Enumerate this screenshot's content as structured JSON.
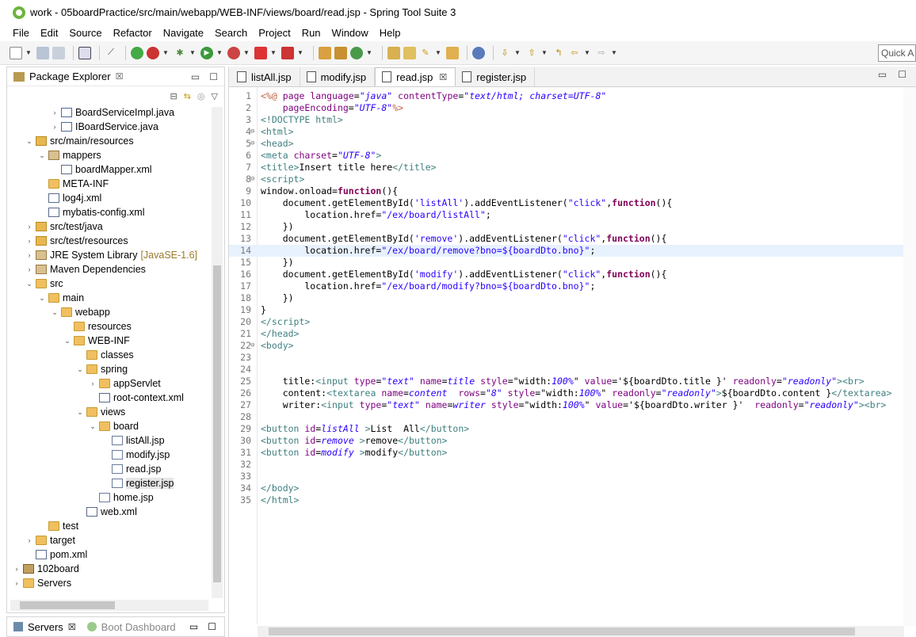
{
  "window": {
    "title": "work - 05boardPractice/src/main/webapp/WEB-INF/views/board/read.jsp - Spring Tool Suite 3"
  },
  "menu": [
    "File",
    "Edit",
    "Source",
    "Refactor",
    "Navigate",
    "Search",
    "Project",
    "Run",
    "Window",
    "Help"
  ],
  "toolbar": {
    "quick_access_placeholder": "Quick A"
  },
  "package_explorer": {
    "tab_label": "Package Explorer",
    "tree": [
      {
        "depth": 3,
        "arrow": ">",
        "icon": "java",
        "label": "BoardServiceImpl.java"
      },
      {
        "depth": 3,
        "arrow": ">",
        "icon": "java",
        "label": "IBoardService.java"
      },
      {
        "depth": 1,
        "arrow": "v",
        "icon": "pkgfolder",
        "label": "src/main/resources"
      },
      {
        "depth": 2,
        "arrow": "v",
        "icon": "pkg",
        "label": "mappers"
      },
      {
        "depth": 3,
        "arrow": "",
        "icon": "xml",
        "label": "boardMapper.xml"
      },
      {
        "depth": 2,
        "arrow": "",
        "icon": "folder",
        "label": "META-INF"
      },
      {
        "depth": 2,
        "arrow": "",
        "icon": "xml",
        "label": "log4j.xml"
      },
      {
        "depth": 2,
        "arrow": "",
        "icon": "xml",
        "label": "mybatis-config.xml"
      },
      {
        "depth": 1,
        "arrow": ">",
        "icon": "pkgfolder",
        "label": "src/test/java"
      },
      {
        "depth": 1,
        "arrow": ">",
        "icon": "pkgfolder",
        "label": "src/test/resources"
      },
      {
        "depth": 1,
        "arrow": ">",
        "icon": "lib",
        "label": "JRE System Library",
        "decor": "[JavaSE-1.6]"
      },
      {
        "depth": 1,
        "arrow": ">",
        "icon": "lib",
        "label": "Maven Dependencies"
      },
      {
        "depth": 1,
        "arrow": "v",
        "icon": "folder",
        "label": "src"
      },
      {
        "depth": 2,
        "arrow": "v",
        "icon": "folder",
        "label": "main"
      },
      {
        "depth": 3,
        "arrow": "v",
        "icon": "folder",
        "label": "webapp"
      },
      {
        "depth": 4,
        "arrow": "",
        "icon": "folder",
        "label": "resources"
      },
      {
        "depth": 4,
        "arrow": "v",
        "icon": "folder",
        "label": "WEB-INF"
      },
      {
        "depth": 5,
        "arrow": "",
        "icon": "folder",
        "label": "classes"
      },
      {
        "depth": 5,
        "arrow": "v",
        "icon": "folder",
        "label": "spring"
      },
      {
        "depth": 6,
        "arrow": ">",
        "icon": "folder",
        "label": "appServlet"
      },
      {
        "depth": 6,
        "arrow": "",
        "icon": "xml",
        "label": "root-context.xml"
      },
      {
        "depth": 5,
        "arrow": "v",
        "icon": "folder",
        "label": "views"
      },
      {
        "depth": 6,
        "arrow": "v",
        "icon": "folder",
        "label": "board"
      },
      {
        "depth": 7,
        "arrow": "",
        "icon": "file",
        "label": "listAll.jsp"
      },
      {
        "depth": 7,
        "arrow": "",
        "icon": "file",
        "label": "modify.jsp"
      },
      {
        "depth": 7,
        "arrow": "",
        "icon": "file",
        "label": "read.jsp"
      },
      {
        "depth": 7,
        "arrow": "",
        "icon": "file",
        "label": "register.jsp",
        "selected": true
      },
      {
        "depth": 6,
        "arrow": "",
        "icon": "file",
        "label": "home.jsp"
      },
      {
        "depth": 5,
        "arrow": "",
        "icon": "xml",
        "label": "web.xml"
      },
      {
        "depth": 2,
        "arrow": "",
        "icon": "folder",
        "label": "test"
      },
      {
        "depth": 1,
        "arrow": ">",
        "icon": "folder",
        "label": "target"
      },
      {
        "depth": 1,
        "arrow": "",
        "icon": "xml",
        "label": "pom.xml"
      },
      {
        "depth": 0,
        "arrow": ">",
        "icon": "proj",
        "label": "102board"
      },
      {
        "depth": 0,
        "arrow": ">",
        "icon": "folder",
        "label": "Servers"
      }
    ]
  },
  "bottom_panel": {
    "servers_tab": "Servers",
    "boot_dashboard_tab": "Boot Dashboard"
  },
  "editor": {
    "tabs": [
      {
        "label": "listAll.jsp",
        "active": false
      },
      {
        "label": "modify.jsp",
        "active": false
      },
      {
        "label": "read.jsp",
        "active": true
      },
      {
        "label": "register.jsp",
        "active": false
      }
    ],
    "highlighted_line": 14,
    "lines": [
      {
        "n": "1",
        "fold": "",
        "html": "<span class=\"t-dir\">&lt;%@</span> <span class=\"t-attr\">page</span> <span class=\"t-attr\">language</span>=<span class=\"t-str\">\"java\"</span> <span class=\"t-attr\">contentType</span>=<span class=\"t-str\">\"text/html; charset=UTF-8\"</span>"
      },
      {
        "n": "2",
        "fold": "",
        "html": "    <span class=\"t-attr\">pageEncoding</span>=<span class=\"t-str\">\"UTF-8\"</span><span class=\"t-dir\">%&gt;</span>"
      },
      {
        "n": "3",
        "fold": "",
        "html": "<span class=\"t-tag\">&lt;!DOCTYPE html&gt;</span>"
      },
      {
        "n": "4",
        "fold": "⊖",
        "html": "<span class=\"t-tag\">&lt;html&gt;</span>"
      },
      {
        "n": "5",
        "fold": "⊖",
        "html": "<span class=\"t-tag\">&lt;head&gt;</span>"
      },
      {
        "n": "6",
        "fold": "",
        "html": "<span class=\"t-tag\">&lt;meta</span> <span class=\"t-attr\">charset</span>=<span class=\"t-str\">\"UTF-8\"</span><span class=\"t-tag\">&gt;</span>"
      },
      {
        "n": "7",
        "fold": "",
        "html": "<span class=\"t-tag\">&lt;title&gt;</span>Insert title here<span class=\"t-tag\">&lt;/title&gt;</span>"
      },
      {
        "n": "8",
        "fold": "⊖",
        "html": "<span class=\"t-tag\">&lt;script&gt;</span>"
      },
      {
        "n": "9",
        "fold": "",
        "html": "window.onload=<span class=\"t-kw\">function</span>(){"
      },
      {
        "n": "10",
        "fold": "",
        "html": "    document.getElementById(<span class=\"t-jsstr\">'listAll'</span>).addEventListener(<span class=\"t-jsstr\">\"click\"</span>,<span class=\"t-kw\">function</span>(){"
      },
      {
        "n": "11",
        "fold": "",
        "html": "        location.href=<span class=\"t-jsstr\">\"/ex/board/listAll\"</span>;"
      },
      {
        "n": "12",
        "fold": "",
        "html": "    })"
      },
      {
        "n": "13",
        "fold": "",
        "html": "    document.getElementById(<span class=\"t-jsstr\">'remove'</span>).addEventListener(<span class=\"t-jsstr\">\"click\"</span>,<span class=\"t-kw\">function</span>(){"
      },
      {
        "n": "14",
        "fold": "",
        "html": "        location.href=<span class=\"t-jsstr\">\"/ex/board/remove?bno=${boardDto.bno}\"</span>;"
      },
      {
        "n": "15",
        "fold": "",
        "html": "    })"
      },
      {
        "n": "16",
        "fold": "",
        "html": "    document.getElementById(<span class=\"t-jsstr\">'modify'</span>).addEventListener(<span class=\"t-jsstr\">\"click\"</span>,<span class=\"t-kw\">function</span>(){"
      },
      {
        "n": "17",
        "fold": "",
        "html": "        location.href=<span class=\"t-jsstr\">\"/ex/board/modify?bno=${boardDto.bno}\"</span>;"
      },
      {
        "n": "18",
        "fold": "",
        "html": "    })"
      },
      {
        "n": "19",
        "fold": "",
        "html": "}"
      },
      {
        "n": "20",
        "fold": "",
        "html": "<span class=\"t-tag\">&lt;/script&gt;</span>"
      },
      {
        "n": "21",
        "fold": "",
        "html": "<span class=\"t-tag\">&lt;/head&gt;</span>"
      },
      {
        "n": "22",
        "fold": "⊖",
        "html": "<span class=\"t-tag\">&lt;body&gt;</span>"
      },
      {
        "n": "23",
        "fold": "",
        "html": ""
      },
      {
        "n": "24",
        "fold": "",
        "html": ""
      },
      {
        "n": "25",
        "fold": "",
        "html": "    title:<span class=\"t-tag\">&lt;input</span> <span class=\"t-attr\">type</span>=<span class=\"t-str\">\"text\"</span> <span class=\"t-attr\">name</span>=<span class=\"t-str\">title</span> <span class=\"t-attr\">style</span>=\"width:<span class=\"t-str\">100%</span>\" <span class=\"t-attr\">value</span>='${boardDto.title }' <span class=\"t-attr\">readonly</span>=<span class=\"t-str\">\"readonly\"</span><span class=\"t-tag\">&gt;&lt;br&gt;</span>"
      },
      {
        "n": "26",
        "fold": "",
        "html": "    content:<span class=\"t-tag\">&lt;textarea</span> <span class=\"t-attr\">name</span>=<span class=\"t-str\">content</span>  <span class=\"t-attr\">rows</span>=<span class=\"t-str\">\"8\"</span> <span class=\"t-attr\">style</span>=\"width:<span class=\"t-str\">100%</span>\" <span class=\"t-attr\">readonly</span>=<span class=\"t-str\">\"readonly\"</span><span class=\"t-tag\">&gt;</span>${boardDto.content }<span class=\"t-tag\">&lt;/textarea&gt;</span>"
      },
      {
        "n": "27",
        "fold": "",
        "html": "    writer:<span class=\"t-tag\">&lt;input</span> <span class=\"t-attr\">type</span>=<span class=\"t-str\">\"text\"</span> <span class=\"t-attr\">name</span>=<span class=\"t-str\">writer</span> <span class=\"t-attr\">style</span>=\"width:<span class=\"t-str\">100%</span>\" <span class=\"t-attr\">value</span>='${boardDto.writer }'  <span class=\"t-attr\">readonly</span>=<span class=\"t-str\">\"readonly\"</span><span class=\"t-tag\">&gt;&lt;br&gt;</span>"
      },
      {
        "n": "28",
        "fold": "",
        "html": ""
      },
      {
        "n": "29",
        "fold": "",
        "html": "<span class=\"t-tag\">&lt;button</span> <span class=\"t-attr\">id</span>=<span class=\"t-str\">listAll</span> <span class=\"t-tag\">&gt;</span>List  All<span class=\"t-tag\">&lt;/button&gt;</span>"
      },
      {
        "n": "30",
        "fold": "",
        "html": "<span class=\"t-tag\">&lt;button</span> <span class=\"t-attr\">id</span>=<span class=\"t-str\">remove</span> <span class=\"t-tag\">&gt;</span>remove<span class=\"t-tag\">&lt;/button&gt;</span>"
      },
      {
        "n": "31",
        "fold": "",
        "html": "<span class=\"t-tag\">&lt;button</span> <span class=\"t-attr\">id</span>=<span class=\"t-str\">modify</span> <span class=\"t-tag\">&gt;</span>modify<span class=\"t-tag\">&lt;/button&gt;</span>"
      },
      {
        "n": "32",
        "fold": "",
        "html": ""
      },
      {
        "n": "33",
        "fold": "",
        "html": ""
      },
      {
        "n": "34",
        "fold": "",
        "html": "<span class=\"t-tag\">&lt;/body&gt;</span>"
      },
      {
        "n": "35",
        "fold": "",
        "html": "<span class=\"t-tag\">&lt;/html&gt;</span>"
      }
    ]
  }
}
